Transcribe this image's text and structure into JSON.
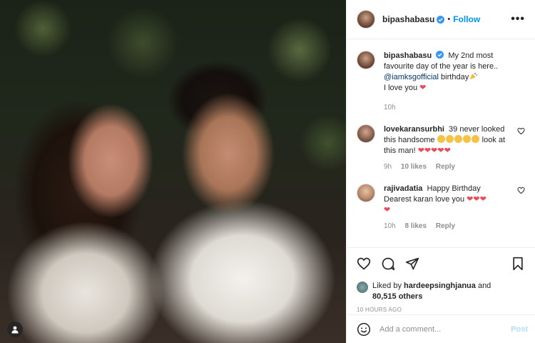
{
  "post": {
    "username": "bipashabasu",
    "follow_label": "Follow",
    "separator": "•",
    "more_label": "•••"
  },
  "caption": {
    "username": "bipashabasu",
    "text_before": "My 2nd most favourite day of the year is here..",
    "mention": "@iamksgofficial",
    "text_after": " birthday",
    "line2": "I love you",
    "heart": "❤",
    "time": "10h"
  },
  "comments": [
    {
      "username": "lovekaransurbhi",
      "text": "39 never looked this handsome",
      "text2": " look at this man!",
      "hearts": "❤❤❤❤❤",
      "time": "9h",
      "likes": "10 likes",
      "reply": "Reply"
    },
    {
      "username": "rajivadatia",
      "text": "Happy Birthday Dearest karan love you ",
      "hearts": "❤❤❤",
      "hearts2": "❤",
      "time": "10h",
      "likes": "8 likes",
      "reply": "Reply"
    }
  ],
  "likes": {
    "prefix": "Liked by ",
    "user": "hardeepsinghjanua",
    "and": " and",
    "count": "80,515 others"
  },
  "timestamp": "10 HOURS AGO",
  "add_comment": {
    "placeholder": "Add a comment...",
    "post_label": "Post"
  },
  "colors": {
    "accent": "#0095f6",
    "heart": "#ed4956",
    "post_disabled": "#b2dffc",
    "mention": "#00376b"
  },
  "icons": {
    "verified": "verified-badge-icon",
    "like": "heart-icon",
    "comment": "comment-icon",
    "share": "share-icon",
    "save": "bookmark-icon",
    "emoji": "smiley-icon",
    "user_tag": "user-tag-icon"
  }
}
